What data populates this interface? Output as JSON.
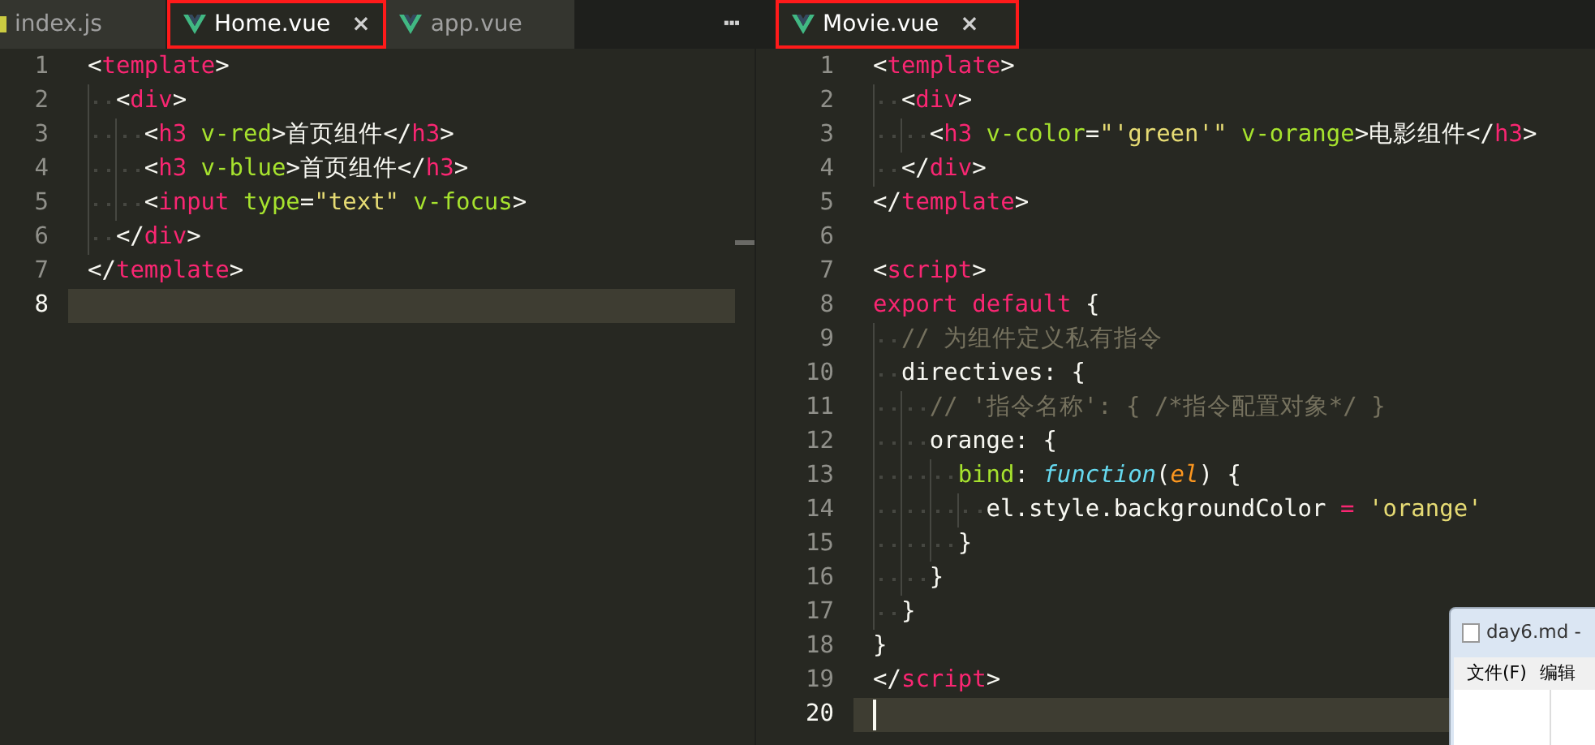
{
  "left_pane": {
    "tabs": [
      {
        "label": "index.js",
        "kind": "js",
        "selected": false,
        "highlighted": false
      },
      {
        "label": "Home.vue",
        "kind": "vue",
        "selected": true,
        "highlighted": true,
        "close": "×"
      },
      {
        "label": "app.vue",
        "kind": "vue",
        "selected": false,
        "highlighted": false
      }
    ],
    "more": "···",
    "lines": [
      {
        "number": "1",
        "current": false,
        "tokens": [
          {
            "kind": "punct",
            "text": "<"
          },
          {
            "kind": "tag",
            "text": "template"
          },
          {
            "kind": "punct",
            "text": ">"
          }
        ],
        "children": [
          {
            "number": "2",
            "current": false,
            "tokens": [
              {
                "kind": "punct",
                "text": "<"
              },
              {
                "kind": "tag",
                "text": "div"
              },
              {
                "kind": "punct",
                "text": ">"
              }
            ],
            "children": [
              {
                "number": "3",
                "current": false,
                "tokens": [
                  {
                    "kind": "punct",
                    "text": "<"
                  },
                  {
                    "kind": "tag",
                    "text": "h3"
                  },
                  {
                    "kind": "attr",
                    "text": " v-red"
                  },
                  {
                    "kind": "punct",
                    "text": ">"
                  },
                  {
                    "kind": "text",
                    "text": "首页组件"
                  },
                  {
                    "kind": "punct",
                    "text": "</"
                  },
                  {
                    "kind": "tag",
                    "text": "h3"
                  },
                  {
                    "kind": "punct",
                    "text": ">"
                  }
                ]
              },
              {
                "number": "4",
                "current": false,
                "tokens": [
                  {
                    "kind": "punct",
                    "text": "<"
                  },
                  {
                    "kind": "tag",
                    "text": "h3"
                  },
                  {
                    "kind": "attr",
                    "text": " v-blue"
                  },
                  {
                    "kind": "punct",
                    "text": ">"
                  },
                  {
                    "kind": "text",
                    "text": "首页组件"
                  },
                  {
                    "kind": "punct",
                    "text": "</"
                  },
                  {
                    "kind": "tag",
                    "text": "h3"
                  },
                  {
                    "kind": "punct",
                    "text": ">"
                  }
                ]
              },
              {
                "number": "5",
                "current": false,
                "tokens": [
                  {
                    "kind": "punct",
                    "text": "<"
                  },
                  {
                    "kind": "tag",
                    "text": "input"
                  },
                  {
                    "kind": "attr",
                    "text": " type"
                  },
                  {
                    "kind": "punct",
                    "text": "="
                  },
                  {
                    "kind": "string",
                    "text": "\"text\""
                  },
                  {
                    "kind": "attr",
                    "text": " v-focus"
                  },
                  {
                    "kind": "punct",
                    "text": ">"
                  }
                ]
              }
            ]
          },
          {
            "number": "6",
            "current": false,
            "tokens": [
              {
                "kind": "punct",
                "text": "</"
              },
              {
                "kind": "tag",
                "text": "div"
              },
              {
                "kind": "punct",
                "text": ">"
              }
            ]
          }
        ]
      },
      {
        "number": "7",
        "current": false,
        "tokens": [
          {
            "kind": "punct",
            "text": "</"
          },
          {
            "kind": "tag",
            "text": "template"
          },
          {
            "kind": "punct",
            "text": ">"
          }
        ]
      },
      {
        "number": "8",
        "current": true
      }
    ]
  },
  "right_pane": {
    "tabs": [
      {
        "label": "Movie.vue",
        "kind": "vue",
        "selected": true,
        "highlighted": true,
        "close": "×"
      }
    ],
    "lines": [
      {
        "number": "1",
        "current": false,
        "tokens": [
          {
            "kind": "punct",
            "text": "<"
          },
          {
            "kind": "tag",
            "text": "template"
          },
          {
            "kind": "punct",
            "text": ">"
          }
        ],
        "children": [
          {
            "number": "2",
            "current": false,
            "tokens": [
              {
                "kind": "punct",
                "text": "<"
              },
              {
                "kind": "tag",
                "text": "div"
              },
              {
                "kind": "punct",
                "text": ">"
              }
            ],
            "children": [
              {
                "number": "3",
                "current": false,
                "tokens": [
                  {
                    "kind": "punct",
                    "text": "<"
                  },
                  {
                    "kind": "tag",
                    "text": "h3"
                  },
                  {
                    "kind": "attr",
                    "text": " v-color"
                  },
                  {
                    "kind": "punct",
                    "text": "="
                  },
                  {
                    "kind": "string",
                    "text": "\"'green'\""
                  },
                  {
                    "kind": "attr",
                    "text": " v-orange"
                  },
                  {
                    "kind": "punct",
                    "text": ">"
                  },
                  {
                    "kind": "text",
                    "text": "电影组件"
                  },
                  {
                    "kind": "punct",
                    "text": "</"
                  },
                  {
                    "kind": "tag",
                    "text": "h3"
                  },
                  {
                    "kind": "punct",
                    "text": ">"
                  }
                ]
              }
            ]
          },
          {
            "number": "4",
            "current": false,
            "tokens": [
              {
                "kind": "punct",
                "text": "</"
              },
              {
                "kind": "tag",
                "text": "div"
              },
              {
                "kind": "punct",
                "text": ">"
              }
            ]
          }
        ]
      },
      {
        "number": "5",
        "current": false,
        "tokens": [
          {
            "kind": "punct",
            "text": "</"
          },
          {
            "kind": "tag",
            "text": "template"
          },
          {
            "kind": "punct",
            "text": ">"
          }
        ]
      },
      {
        "number": "6",
        "current": false
      },
      {
        "number": "7",
        "current": false,
        "tokens": [
          {
            "kind": "punct",
            "text": "<"
          },
          {
            "kind": "tag",
            "text": "script"
          },
          {
            "kind": "punct",
            "text": ">"
          }
        ]
      },
      {
        "number": "8",
        "current": false,
        "tokens": [
          {
            "kind": "keyword",
            "text": "export default"
          },
          {
            "kind": "punct",
            "text": " {"
          }
        ],
        "children": [
          {
            "number": "9",
            "current": false,
            "tokens": [
              {
                "kind": "comment",
                "text": "// 为组件定义私有指令"
              }
            ]
          },
          {
            "number": "10",
            "current": false,
            "tokens": [
              {
                "kind": "plain",
                "text": "directives: {"
              }
            ],
            "children": [
              {
                "number": "11",
                "current": false,
                "tokens": [
                  {
                    "kind": "comment",
                    "text": "// '指令名称': { /*指令配置对象*/ }"
                  }
                ]
              },
              {
                "number": "12",
                "current": false,
                "tokens": [
                  {
                    "kind": "plain",
                    "text": "orange: {"
                  }
                ],
                "children": [
                  {
                    "number": "13",
                    "current": false,
                    "tokens": [
                      {
                        "kind": "attr",
                        "text": "bind"
                      },
                      {
                        "kind": "punct",
                        "text": ": "
                      },
                      {
                        "kind": "func",
                        "text": "function"
                      },
                      {
                        "kind": "punct",
                        "text": "("
                      },
                      {
                        "kind": "param",
                        "text": "el"
                      },
                      {
                        "kind": "punct",
                        "text": ") {"
                      }
                    ],
                    "children": [
                      {
                        "number": "14",
                        "current": false,
                        "tokens": [
                          {
                            "kind": "plain",
                            "text": "el.style.backgroundColor "
                          },
                          {
                            "kind": "keyword",
                            "text": "="
                          },
                          {
                            "kind": "string",
                            "text": " 'orange'"
                          }
                        ]
                      }
                    ]
                  },
                  {
                    "number": "15",
                    "current": false,
                    "tokens": [
                      {
                        "kind": "punct",
                        "text": "}"
                      }
                    ]
                  }
                ]
              },
              {
                "number": "16",
                "current": false,
                "tokens": [
                  {
                    "kind": "punct",
                    "text": "}"
                  }
                ]
              }
            ]
          },
          {
            "number": "17",
            "current": false,
            "tokens": [
              {
                "kind": "punct",
                "text": "}"
              }
            ]
          }
        ]
      },
      {
        "number": "18",
        "current": false,
        "tokens": [
          {
            "kind": "punct",
            "text": "}"
          }
        ]
      },
      {
        "number": "19",
        "current": false,
        "tokens": [
          {
            "kind": "punct",
            "text": "</"
          },
          {
            "kind": "tag",
            "text": "script"
          },
          {
            "kind": "punct",
            "text": ">"
          }
        ]
      },
      {
        "number": "20",
        "current": true
      }
    ]
  },
  "notepad": {
    "title": "day6.md -",
    "menu": [
      "文件(F)",
      "编辑"
    ]
  }
}
